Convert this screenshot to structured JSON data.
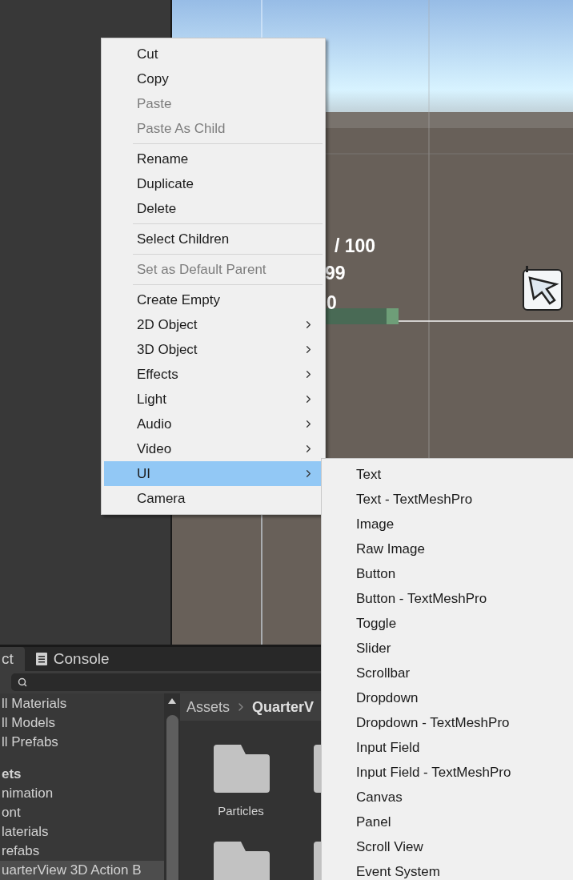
{
  "scene_view": {
    "hud": [
      {
        "text": "/ 100",
        "kind": "value"
      },
      {
        "text": "99",
        "kind": "value"
      },
      {
        "text": "0",
        "kind": "value"
      }
    ]
  },
  "context_menu": {
    "groups": [
      [
        {
          "label": "Cut",
          "disabled": false,
          "has_submenu": false,
          "selected": false
        },
        {
          "label": "Copy",
          "disabled": false,
          "has_submenu": false,
          "selected": false
        },
        {
          "label": "Paste",
          "disabled": true,
          "has_submenu": false,
          "selected": false
        },
        {
          "label": "Paste As Child",
          "disabled": true,
          "has_submenu": false,
          "selected": false
        }
      ],
      [
        {
          "label": "Rename",
          "disabled": false,
          "has_submenu": false,
          "selected": false
        },
        {
          "label": "Duplicate",
          "disabled": false,
          "has_submenu": false,
          "selected": false
        },
        {
          "label": "Delete",
          "disabled": false,
          "has_submenu": false,
          "selected": false
        }
      ],
      [
        {
          "label": "Select Children",
          "disabled": false,
          "has_submenu": false,
          "selected": false
        }
      ],
      [
        {
          "label": "Set as Default Parent",
          "disabled": true,
          "has_submenu": false,
          "selected": false
        }
      ],
      [
        {
          "label": "Create Empty",
          "disabled": false,
          "has_submenu": false,
          "selected": false
        },
        {
          "label": "2D Object",
          "disabled": false,
          "has_submenu": true,
          "selected": false
        },
        {
          "label": "3D Object",
          "disabled": false,
          "has_submenu": true,
          "selected": false
        },
        {
          "label": "Effects",
          "disabled": false,
          "has_submenu": true,
          "selected": false
        },
        {
          "label": "Light",
          "disabled": false,
          "has_submenu": true,
          "selected": false
        },
        {
          "label": "Audio",
          "disabled": false,
          "has_submenu": true,
          "selected": false
        },
        {
          "label": "Video",
          "disabled": false,
          "has_submenu": true,
          "selected": false
        },
        {
          "label": "UI",
          "disabled": false,
          "has_submenu": true,
          "selected": true
        },
        {
          "label": "Camera",
          "disabled": false,
          "has_submenu": false,
          "selected": false
        }
      ]
    ]
  },
  "submenu": {
    "items": [
      "Text",
      "Text - TextMeshPro",
      "Image",
      "Raw Image",
      "Button",
      "Button - TextMeshPro",
      "Toggle",
      "Slider",
      "Scrollbar",
      "Dropdown",
      "Dropdown - TextMeshPro",
      "Input Field",
      "Input Field - TextMeshPro",
      "Canvas",
      "Panel",
      "Scroll View",
      "Event System"
    ]
  },
  "bottom_panel": {
    "tabs": [
      {
        "label": "ct",
        "selected": true
      },
      {
        "label": "Console",
        "selected": false
      }
    ],
    "tree": [
      {
        "label": "ll Materials",
        "selected": false
      },
      {
        "label": "ll Models",
        "selected": false
      },
      {
        "label": "ll Prefabs",
        "selected": false
      },
      {
        "label": "ets",
        "selected": false,
        "children": [
          {
            "label": "nimation",
            "selected": false
          },
          {
            "label": "ont",
            "selected": false
          },
          {
            "label": "laterials",
            "selected": false
          },
          {
            "label": "refabs",
            "selected": false
          },
          {
            "label": "uarterView 3D Action B",
            "selected": true
          }
        ]
      }
    ],
    "breadcrumb": [
      {
        "label": "Assets",
        "kind": "plain"
      },
      {
        "label": "QuarterV",
        "kind": "current"
      }
    ],
    "folders": [
      {
        "label": "Particles"
      }
    ]
  }
}
